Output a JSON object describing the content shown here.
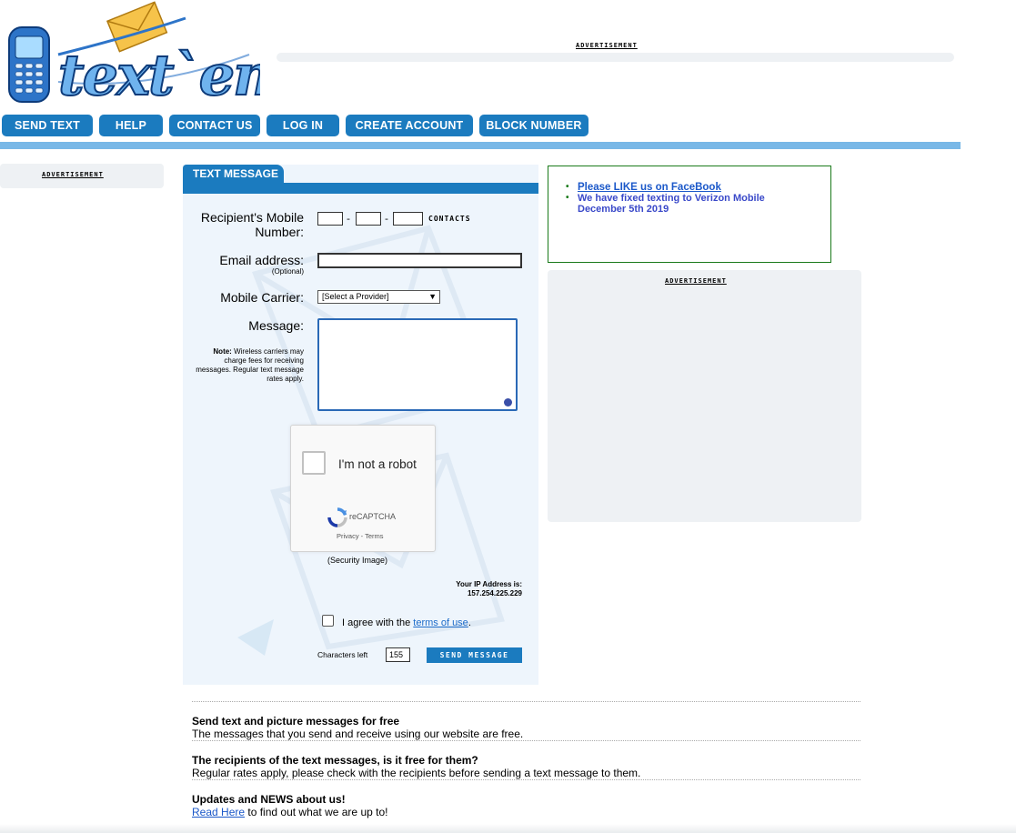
{
  "brand": {
    "logo_text": "text`em"
  },
  "ads": {
    "label": "ADVERTISEMENT"
  },
  "nav": {
    "items": [
      {
        "label": "SEND TEXT"
      },
      {
        "label": "HELP"
      },
      {
        "label": "CONTACT US"
      },
      {
        "label": "LOG IN"
      },
      {
        "label": "CREATE ACCOUNT"
      },
      {
        "label": "BLOCK NUMBER"
      }
    ]
  },
  "form": {
    "tab_title": "TEXT MESSAGE",
    "mobile_label": "Recipient's Mobile Number:",
    "phone_separator": "-",
    "contacts_link": "CONTACTS",
    "email_label": "Email address:",
    "email_optional": "(Optional)",
    "carrier_label": "Mobile Carrier:",
    "carrier_selected": "[Select a Provider]",
    "message_label": "Message:",
    "note_title": "Note:",
    "note_text": "Wireless carriers may charge fees for receiving messages. Regular text message rates apply.",
    "captcha": {
      "checkbox_label": "I'm not a robot",
      "brand": "reCAPTCHA",
      "links": "Privacy - Terms"
    },
    "security_image_label": "(Security Image)",
    "ip_label": "Your IP Address is:",
    "ip_value": "157.254.225.229",
    "agree_prefix": "I agree with the",
    "agree_link": "terms of use",
    "agree_suffix": ".",
    "chars_left_label": "Characters left",
    "chars_left_value": "155",
    "send_button": "SEND MESSAGE"
  },
  "news": {
    "link_text": "Please LIKE us on FaceBook",
    "message": "We have fixed texting to Verizon Mobile December 5th 2019"
  },
  "faq": [
    {
      "q": "Send text and picture messages for free",
      "a": "The messages that you send and receive using our website are free."
    },
    {
      "q": "The recipients of the text messages, is it free for them?",
      "a": "Regular rates apply, please check with the recipients before sending a text message to them."
    },
    {
      "q": "Updates and NEWS about us!",
      "a_link": "Read Here",
      "a_rest": " to find out what we are up to!"
    }
  ],
  "colors": {
    "brand_blue": "#1b7bbf",
    "rule_blue": "#79b8e7",
    "panel_bg": "#eef5fc",
    "news_border": "#1a7a1a"
  }
}
